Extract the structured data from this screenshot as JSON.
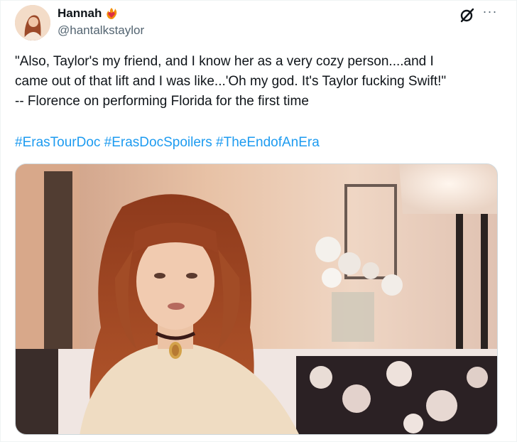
{
  "user": {
    "display_name": "Hannah",
    "handle": "@hantalkstaylor",
    "avatar_icon": "avatar-photo",
    "badge_icon": "heart-on-fire-icon"
  },
  "tweet": {
    "text": "\"Also, Taylor's my friend, and I know her as a very cozy person....and I\ncame out of that lift and I was like...'Oh my god. It's Taylor fucking Swift!\"\n-- Florence on performing Florida for the first time",
    "hashtags": [
      "#ErasTourDoc",
      "#ErasDocSpoilers",
      "#TheEndofAnEra"
    ]
  },
  "actions": {
    "grok_icon": "grok-icon",
    "more_icon": "more-icon"
  },
  "colors": {
    "link": "#1d9bf0",
    "text": "#0f1419",
    "secondary": "#536471"
  }
}
